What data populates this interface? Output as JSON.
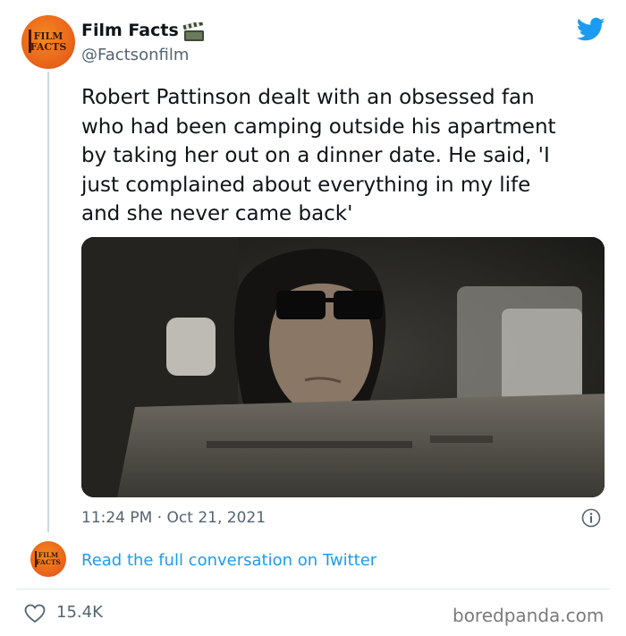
{
  "author": {
    "name": "Film Facts",
    "handle": "@Factsonfilm",
    "avatar_text_line1": "FILM",
    "avatar_text_line2": "FACTS"
  },
  "tweet": {
    "text": "Robert Pattinson dealt with an obsessed fan\nwho had been camping outside his apartment\nby taking her out on a dinner date. He said, 'I\njust complained about everything in my life\nand she never came back'",
    "timestamp": "11:24 PM · Oct 21, 2021",
    "likes": "15.4K",
    "read_link": "Read the full conversation on Twitter"
  },
  "icons": {
    "clapper": "clapper-board-icon",
    "brand": "twitter-bird-icon",
    "info": "info-icon",
    "like": "heart-icon"
  },
  "colors": {
    "link": "#1d9bf0",
    "brand": "#1d9bf0",
    "secondary_text": "#536471",
    "avatar": "#e8601a"
  },
  "watermark": "boredpanda.com"
}
